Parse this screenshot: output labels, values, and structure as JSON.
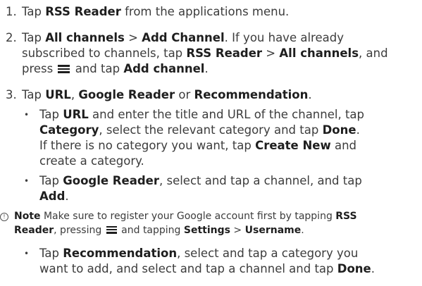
{
  "steps": [
    {
      "num": "1.",
      "lines": [
        [
          {
            "t": "Tap "
          },
          {
            "b": "RSS Reader"
          },
          {
            "t": " from the applications menu."
          }
        ]
      ]
    },
    {
      "num": "2.",
      "lines": [
        [
          {
            "t": "Tap "
          },
          {
            "b": "All channels"
          },
          {
            "t": " > "
          },
          {
            "b": "Add Channel"
          },
          {
            "t": ". If you have already"
          }
        ],
        [
          {
            "t": "subscribed to channels, tap "
          },
          {
            "b": "RSS Reader"
          },
          {
            "t": " > "
          },
          {
            "b": "All channels"
          },
          {
            "t": ", and"
          }
        ],
        [
          {
            "t": "press "
          },
          {
            "icon": "menu-icon"
          },
          {
            "t": " and tap "
          },
          {
            "b": "Add channel"
          },
          {
            "t": "."
          }
        ]
      ]
    },
    {
      "num": "3.",
      "lines": [
        [
          {
            "t": "Tap "
          },
          {
            "b": "URL"
          },
          {
            "t": ", "
          },
          {
            "b": "Google Reader"
          },
          {
            "t": " or "
          },
          {
            "b": "Recommendation"
          },
          {
            "t": "."
          }
        ]
      ]
    }
  ],
  "bullets": [
    {
      "lines": [
        [
          {
            "t": "Tap "
          },
          {
            "b": "URL"
          },
          {
            "t": " and enter the title and URL of the channel, tap"
          }
        ],
        [
          {
            "b": "Category"
          },
          {
            "t": ", select the relevant category and tap "
          },
          {
            "b": "Done"
          },
          {
            "t": "."
          }
        ],
        [
          {
            "t": "If there is no category you want, tap "
          },
          {
            "b": "Create New"
          },
          {
            "t": " and"
          }
        ],
        [
          {
            "t": "create a category."
          }
        ]
      ]
    },
    {
      "lines": [
        [
          {
            "t": "Tap "
          },
          {
            "b": "Google Reader"
          },
          {
            "t": ", select and tap a channel, and tap"
          }
        ],
        [
          {
            "b": "Add"
          },
          {
            "t": "."
          }
        ]
      ]
    },
    {
      "lines": [
        [
          {
            "t": "Tap "
          },
          {
            "b": "Recommendation"
          },
          {
            "t": ", select and tap a category you"
          }
        ],
        [
          {
            "t": "want to add, and select and tap a channel and tap "
          },
          {
            "b": "Done"
          },
          {
            "t": "."
          }
        ]
      ]
    }
  ],
  "note": {
    "symbol": "!",
    "lines": [
      [
        {
          "b": "Note"
        },
        {
          "t": " Make sure to register your Google account first by tapping "
        },
        {
          "b": "RSS"
        }
      ],
      [
        {
          "b": "Reader"
        },
        {
          "t": ", pressing "
        },
        {
          "icon": "menu-icon"
        },
        {
          "t": " and tapping "
        },
        {
          "b": "Settings"
        },
        {
          "t": " > "
        },
        {
          "b": "Username"
        },
        {
          "t": "."
        }
      ]
    ]
  }
}
